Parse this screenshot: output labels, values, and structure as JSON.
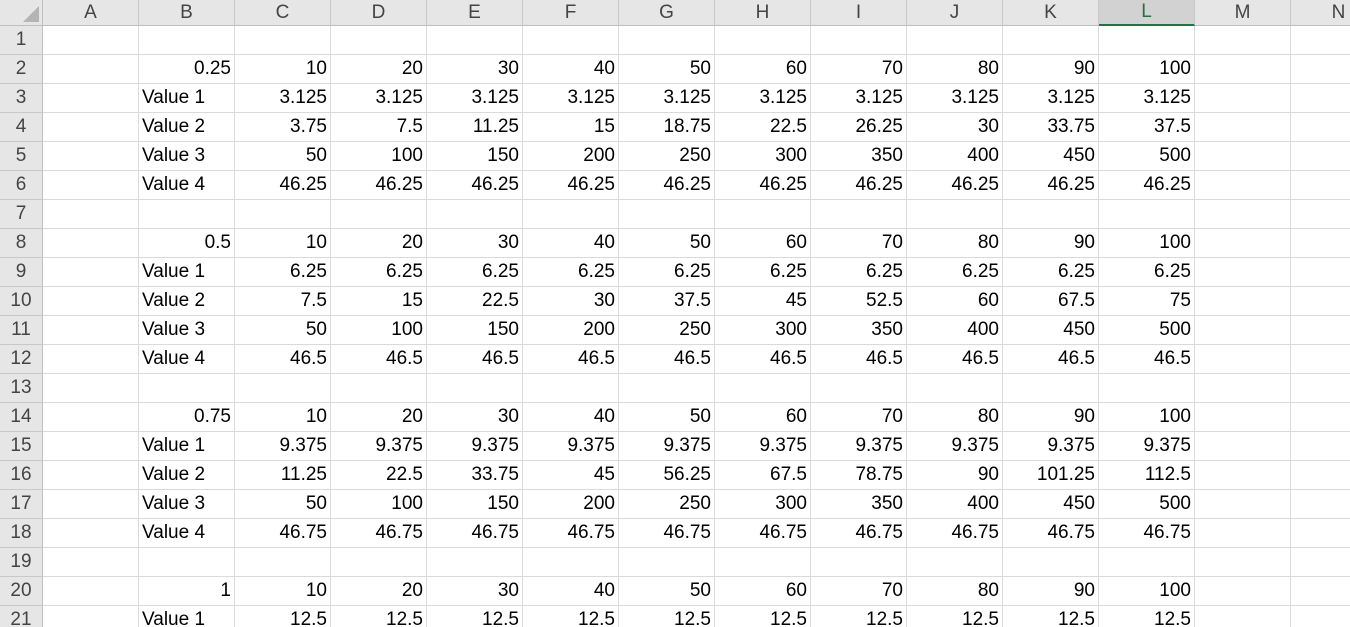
{
  "sheet": {
    "columns": [
      "A",
      "B",
      "C",
      "D",
      "E",
      "F",
      "G",
      "H",
      "I",
      "J",
      "K",
      "L",
      "M",
      "N"
    ],
    "selected_column": "L",
    "rows": [
      [],
      [
        "",
        "0.25",
        "10",
        "20",
        "30",
        "40",
        "50",
        "60",
        "70",
        "80",
        "90",
        "100"
      ],
      [
        "",
        "Value 1",
        "3.125",
        "3.125",
        "3.125",
        "3.125",
        "3.125",
        "3.125",
        "3.125",
        "3.125",
        "3.125",
        "3.125"
      ],
      [
        "",
        "Value 2",
        "3.75",
        "7.5",
        "11.25",
        "15",
        "18.75",
        "22.5",
        "26.25",
        "30",
        "33.75",
        "37.5"
      ],
      [
        "",
        "Value 3",
        "50",
        "100",
        "150",
        "200",
        "250",
        "300",
        "350",
        "400",
        "450",
        "500"
      ],
      [
        "",
        "Value 4",
        "46.25",
        "46.25",
        "46.25",
        "46.25",
        "46.25",
        "46.25",
        "46.25",
        "46.25",
        "46.25",
        "46.25"
      ],
      [],
      [
        "",
        "0.5",
        "10",
        "20",
        "30",
        "40",
        "50",
        "60",
        "70",
        "80",
        "90",
        "100"
      ],
      [
        "",
        "Value 1",
        "6.25",
        "6.25",
        "6.25",
        "6.25",
        "6.25",
        "6.25",
        "6.25",
        "6.25",
        "6.25",
        "6.25"
      ],
      [
        "",
        "Value 2",
        "7.5",
        "15",
        "22.5",
        "30",
        "37.5",
        "45",
        "52.5",
        "60",
        "67.5",
        "75"
      ],
      [
        "",
        "Value 3",
        "50",
        "100",
        "150",
        "200",
        "250",
        "300",
        "350",
        "400",
        "450",
        "500"
      ],
      [
        "",
        "Value 4",
        "46.5",
        "46.5",
        "46.5",
        "46.5",
        "46.5",
        "46.5",
        "46.5",
        "46.5",
        "46.5",
        "46.5"
      ],
      [],
      [
        "",
        "0.75",
        "10",
        "20",
        "30",
        "40",
        "50",
        "60",
        "70",
        "80",
        "90",
        "100"
      ],
      [
        "",
        "Value 1",
        "9.375",
        "9.375",
        "9.375",
        "9.375",
        "9.375",
        "9.375",
        "9.375",
        "9.375",
        "9.375",
        "9.375"
      ],
      [
        "",
        "Value 2",
        "11.25",
        "22.5",
        "33.75",
        "45",
        "56.25",
        "67.5",
        "78.75",
        "90",
        "101.25",
        "112.5"
      ],
      [
        "",
        "Value 3",
        "50",
        "100",
        "150",
        "200",
        "250",
        "300",
        "350",
        "400",
        "450",
        "500"
      ],
      [
        "",
        "Value 4",
        "46.75",
        "46.75",
        "46.75",
        "46.75",
        "46.75",
        "46.75",
        "46.75",
        "46.75",
        "46.75",
        "46.75"
      ],
      [],
      [
        "",
        "1",
        "10",
        "20",
        "30",
        "40",
        "50",
        "60",
        "70",
        "80",
        "90",
        "100"
      ],
      [
        "",
        "Value 1",
        "12.5",
        "12.5",
        "12.5",
        "12.5",
        "12.5",
        "12.5",
        "12.5",
        "12.5",
        "12.5",
        "12.5"
      ]
    ]
  },
  "colors": {
    "header_bg": "#e6e6e6",
    "selected_header_text": "#217346",
    "gridline": "#dadada"
  }
}
